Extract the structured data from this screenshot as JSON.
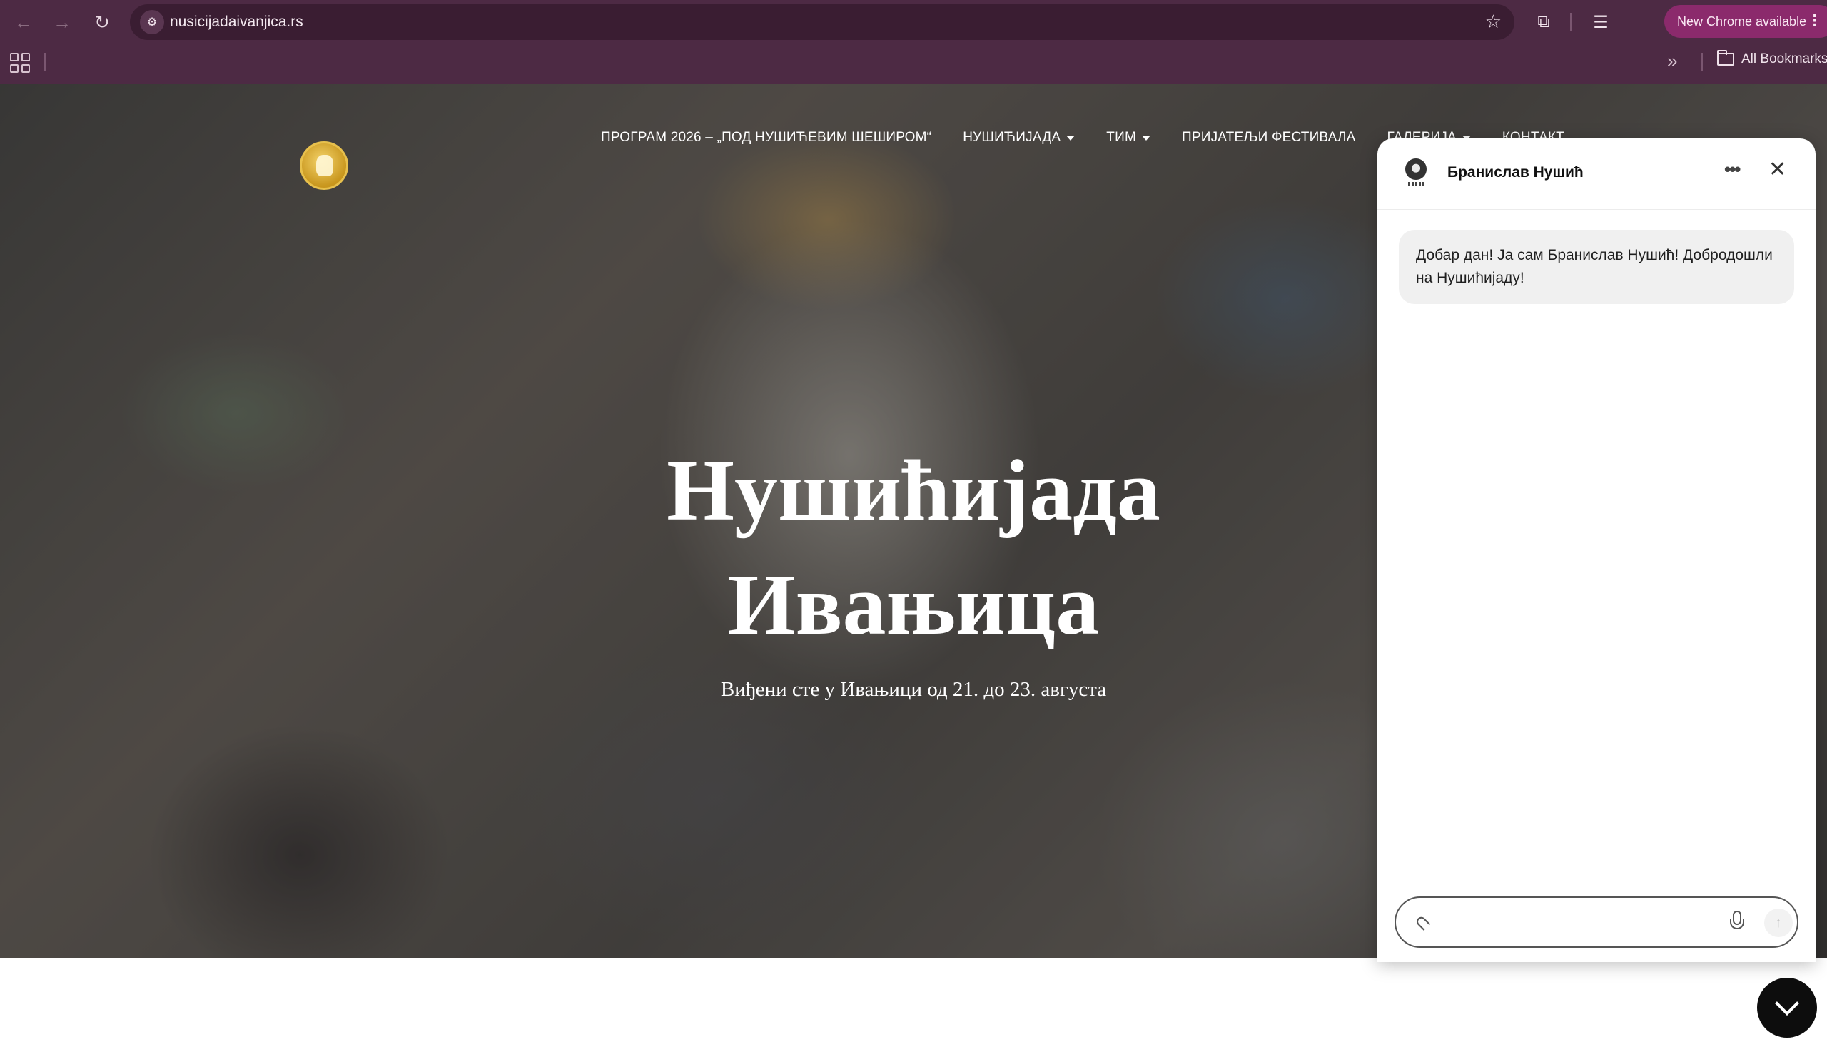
{
  "browser": {
    "url": "nusicijadaivanjica.rs",
    "new_chrome_label": "New Chrome available",
    "all_bookmarks_label": "All Bookmarks"
  },
  "site": {
    "nav": [
      {
        "label": "ПРОГРАМ 2026 – „ПОД НУШИЋЕВИМ ШЕШИРОМ“",
        "dropdown": false
      },
      {
        "label": "НУШИЋИЈАДА",
        "dropdown": true
      },
      {
        "label": "ТИМ",
        "dropdown": true
      },
      {
        "label": "ПРИЈАТЕЉИ ФЕСТИВАЛА",
        "dropdown": false
      },
      {
        "label": "ГАЛЕРИЈА",
        "dropdown": true
      },
      {
        "label": "КОНТАКТ",
        "dropdown": false
      }
    ],
    "hero": {
      "title_line1": "Нушићијада",
      "title_line2": "Ивањица",
      "subtitle": "Виђени сте у Ивањици од 21. до 23. августа"
    }
  },
  "chat": {
    "bot_name": "Бранислав Нушић",
    "greeting": "Добар дан! Ја сам Бранислав Нушић! Добродошли на Нушићијаду!",
    "input_value": ""
  },
  "icons": {
    "back": "arrow-left-icon",
    "forward": "arrow-right-icon",
    "reload": "reload-icon",
    "site_info": "tune-icon",
    "bookmark": "star-icon",
    "extensions": "puzzle-icon",
    "media": "media-playlist-icon",
    "apps": "apps-grid-icon",
    "folder": "folder-icon",
    "chat_more": "more-horizontal-icon",
    "chat_close": "close-icon",
    "attach": "paperclip-icon",
    "mic": "microphone-icon",
    "send": "arrow-up-icon",
    "toggle": "chevron-down-icon"
  }
}
